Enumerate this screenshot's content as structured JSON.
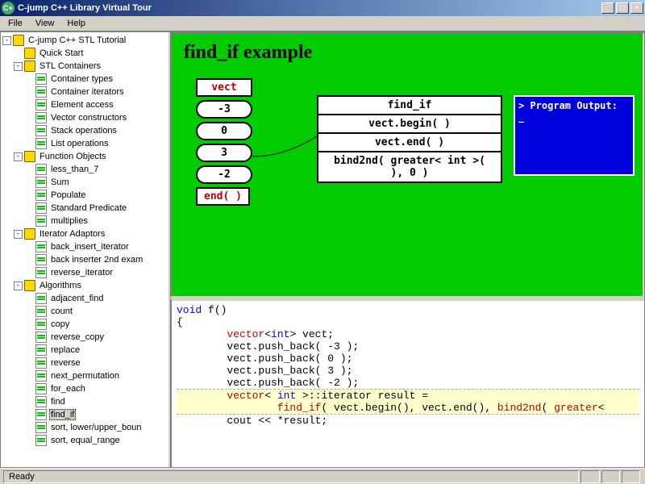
{
  "window": {
    "title": "C-jump C++ Library Virtual Tour",
    "icon_text": "C+"
  },
  "menu": {
    "items": [
      "File",
      "View",
      "Help"
    ]
  },
  "tree": {
    "root": "C-jump C++ STL Tutorial",
    "n_quickstart": "Quick Start",
    "n_stlcont": "STL Containers",
    "n_conttypes": "Container types",
    "n_contiter": "Container iterators",
    "n_elemacc": "Element access",
    "n_vectcons": "Vector constructors",
    "n_stackops": "Stack operations",
    "n_listops": "List operations",
    "n_funcobj": "Function Objects",
    "n_lt7": "less_than_7",
    "n_sum": "Sum",
    "n_pop": "Populate",
    "n_stdpred": "Standard Predicate",
    "n_mult": "multiplies",
    "n_iteradapt": "Iterator Adaptors",
    "n_backins": "back_insert_iterator",
    "n_backins2": "back inserter 2nd exam",
    "n_reviter": "reverse_iterator",
    "n_algo": "Algorithms",
    "n_adjfind": "adjacent_find",
    "n_count": "count",
    "n_copy": "copy",
    "n_revcopy": "reverse_copy",
    "n_replace": "replace",
    "n_reverse": "reverse",
    "n_nextperm": "next_permutation",
    "n_foreach": "for_each",
    "n_find": "find",
    "n_findif": "find_if",
    "n_sortlub": "sort, lower/upper_boun",
    "n_sorteq": "sort, equal_range"
  },
  "diagram": {
    "title": "find_if example",
    "vect_label": "vect",
    "vect_values": [
      "-3",
      "0",
      "3",
      "-2"
    ],
    "end_label": "end( )",
    "call_rows": [
      "find_if",
      "vect.begin( )",
      "vect.end( )",
      "bind2nd( greater< int >( ), 0 )"
    ],
    "output_title": "> Program Output:",
    "output_cursor": "_"
  },
  "code": {
    "l1": "void f()",
    "l2": "{",
    "l3a": "        ",
    "l3b": "vector",
    "l3c": "<",
    "l3d": "int",
    "l3e": "> vect;",
    "l4": "        vect.push_back( -3 );",
    "l5": "        vect.push_back( 0 );",
    "l6": "        vect.push_back( 3 );",
    "l7": "        vect.push_back( -2 );",
    "l8": "",
    "l9a": "        ",
    "l9b": "vector",
    "l9c": "< ",
    "l9d": "int",
    "l9e": " >::iterator result =",
    "l10a": "                ",
    "l10b": "find_if",
    "l10c": "( vect.begin(), vect.end(), ",
    "l10d": "bind2nd",
    "l10e": "( ",
    "l10f": "greater",
    "l10g": "<",
    "l11": "        cout << *result;"
  },
  "status": {
    "text": "Ready"
  }
}
